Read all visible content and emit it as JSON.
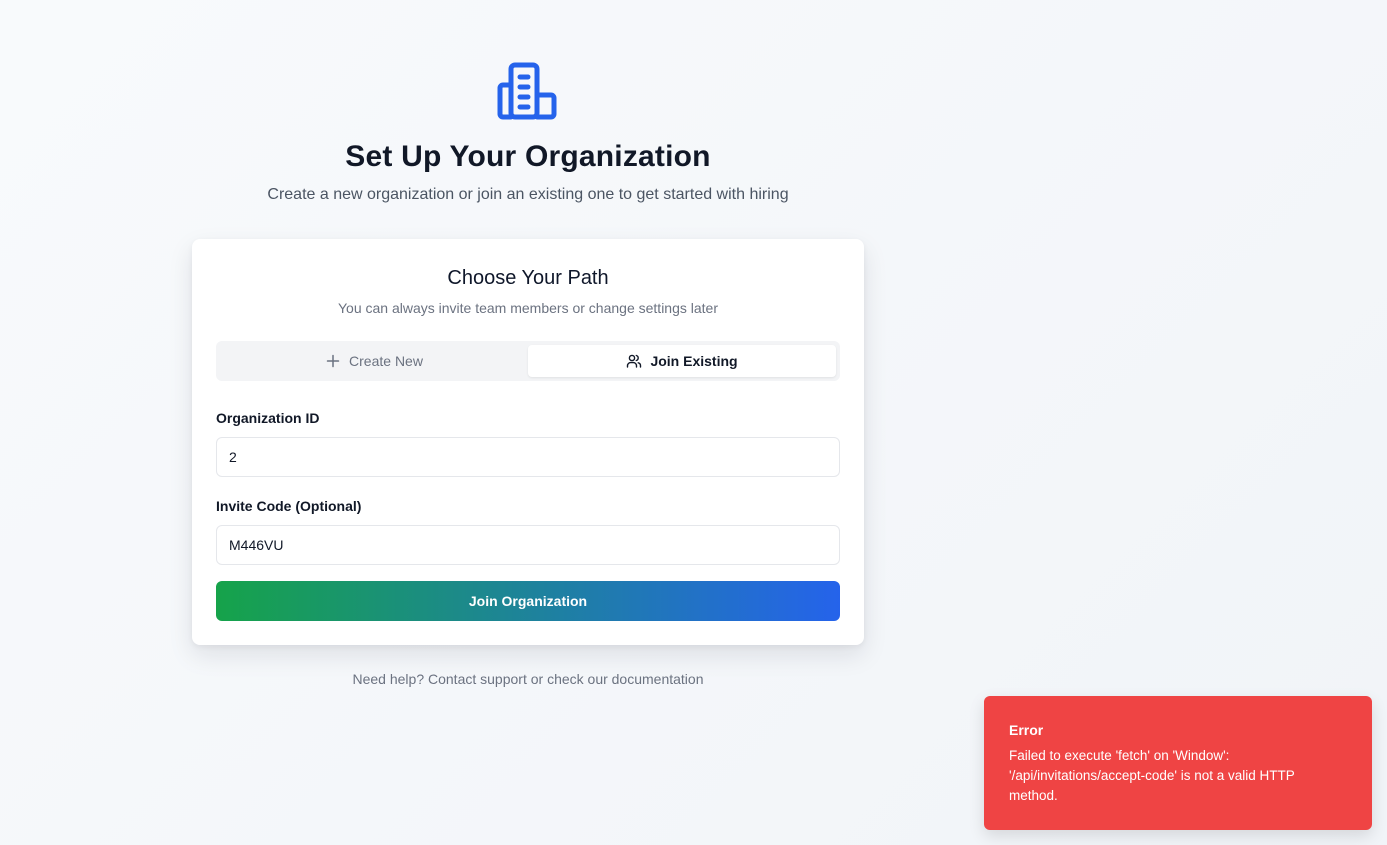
{
  "header": {
    "icon": "building-icon",
    "title": "Set Up Your Organization",
    "subtitle": "Create a new organization or join an existing one to get started with hiring"
  },
  "card": {
    "title": "Choose Your Path",
    "description": "You can always invite team members or change settings later",
    "tabs": [
      {
        "label": "Create New",
        "icon": "plus-icon",
        "active": false
      },
      {
        "label": "Join Existing",
        "icon": "users-icon",
        "active": true
      }
    ],
    "fields": {
      "org_id": {
        "label": "Organization ID",
        "value": "2"
      },
      "invite_code": {
        "label": "Invite Code (Optional)",
        "value": "M446VU"
      }
    },
    "submit_label": "Join Organization"
  },
  "footer": {
    "help_text": "Need help? Contact support or check our documentation"
  },
  "toast": {
    "title": "Error",
    "message": "Failed to execute 'fetch' on 'Window': '/api/invitations/accept-code' is not a valid HTTP method."
  },
  "colors": {
    "accent_blue": "#2563eb",
    "accent_green": "#16a34a",
    "error_red": "#ef4444"
  }
}
